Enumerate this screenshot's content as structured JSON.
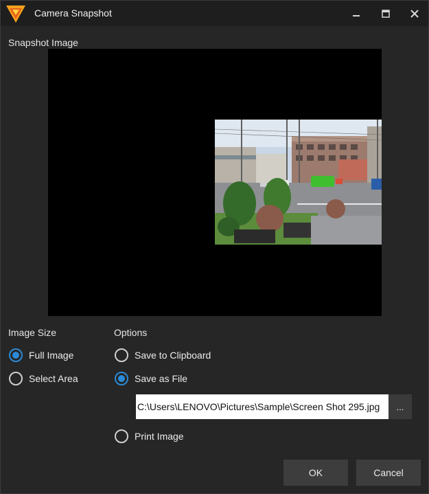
{
  "window": {
    "title": "Camera Snapshot",
    "app_icon": "brand-logo-icon",
    "controls": {
      "minimize": "minimize-icon",
      "maximize": "maximize-icon",
      "close": "close-icon"
    }
  },
  "snapshot": {
    "label": "Snapshot Image"
  },
  "image_size": {
    "label": "Image Size",
    "options": [
      {
        "label": "Full Image",
        "checked": true
      },
      {
        "label": "Select Area",
        "checked": false
      }
    ]
  },
  "options": {
    "label": "Options",
    "save_clipboard": {
      "label": "Save to Clipboard",
      "checked": false
    },
    "save_file": {
      "label": "Save as File",
      "checked": true
    },
    "file_path": "C:\\Users\\LENOVO\\Pictures\\Sample\\Screen Shot 295.jpg",
    "browse_label": "...",
    "print_image": {
      "label": "Print Image",
      "checked": false
    }
  },
  "buttons": {
    "ok": "OK",
    "cancel": "Cancel"
  },
  "colors": {
    "accent": "#2b8ad8",
    "brand_orange": "#f5a11c",
    "background": "#262626",
    "titlebar": "#1e1e1e"
  }
}
